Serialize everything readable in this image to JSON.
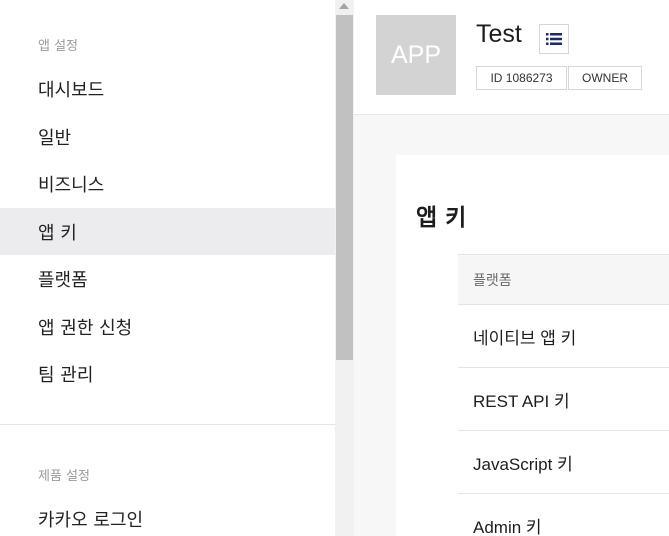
{
  "sidebar": {
    "app_settings_title": "앱 설정",
    "items": [
      {
        "label": "대시보드"
      },
      {
        "label": "일반"
      },
      {
        "label": "비즈니스"
      },
      {
        "label": "앱 키"
      },
      {
        "label": "플랫폼"
      },
      {
        "label": "앱 권한 신청"
      },
      {
        "label": "팀 관리"
      }
    ],
    "product_settings_title": "제품 설정",
    "product_items": [
      {
        "label": "카카오 로그인"
      }
    ],
    "active_item": "앱 키"
  },
  "app": {
    "icon_text": "APP",
    "name": "Test",
    "id_badge": "ID 1086273",
    "role_badge": "OWNER",
    "list_icon": "list-icon"
  },
  "content": {
    "title": "앱 키",
    "table": {
      "header": "플랫폼",
      "rows": [
        {
          "label": "네이티브 앱 키"
        },
        {
          "label": "REST API 키"
        },
        {
          "label": "JavaScript 키"
        },
        {
          "label": "Admin 키"
        }
      ]
    }
  },
  "colors": {
    "active_bg": "#ececee",
    "icon_accent": "#1a2a6c"
  }
}
